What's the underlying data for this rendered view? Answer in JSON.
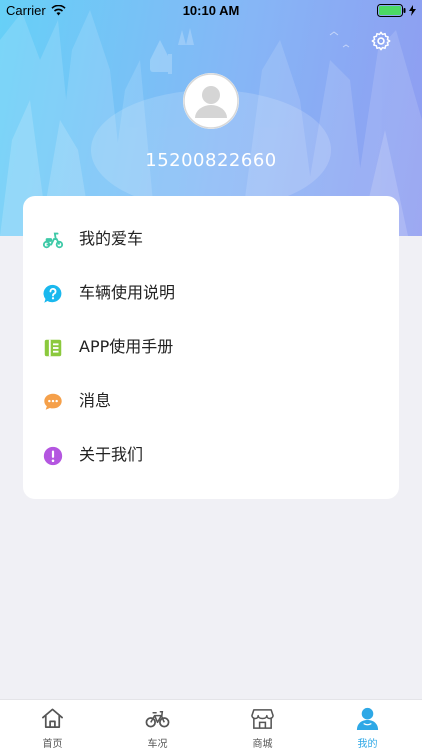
{
  "status_bar": {
    "carrier": "Carrier",
    "time": "10:10 AM"
  },
  "header": {
    "settings_icon": "gear-icon",
    "avatar_icon": "avatar-placeholder-icon",
    "phone": "15200822660"
  },
  "menu": {
    "items": [
      {
        "label": "我的爱车",
        "icon": "scooter-icon",
        "icon_color": "#3ec9a7"
      },
      {
        "label": "车辆使用说明",
        "icon": "question-icon",
        "icon_color": "#1ab8ee"
      },
      {
        "label": "APP使用手册",
        "icon": "manual-icon",
        "icon_color": "#8bc93d"
      },
      {
        "label": "消息",
        "icon": "message-icon",
        "icon_color": "#f5a04a"
      },
      {
        "label": "关于我们",
        "icon": "info-icon",
        "icon_color": "#b456e0"
      }
    ]
  },
  "tabbar": {
    "tabs": [
      {
        "label": "首页",
        "icon": "home-icon"
      },
      {
        "label": "车况",
        "icon": "bicycle-icon"
      },
      {
        "label": "商城",
        "icon": "store-icon"
      },
      {
        "label": "我的",
        "icon": "user-icon",
        "active": true
      }
    ],
    "active_color": "#2ea8e6"
  }
}
